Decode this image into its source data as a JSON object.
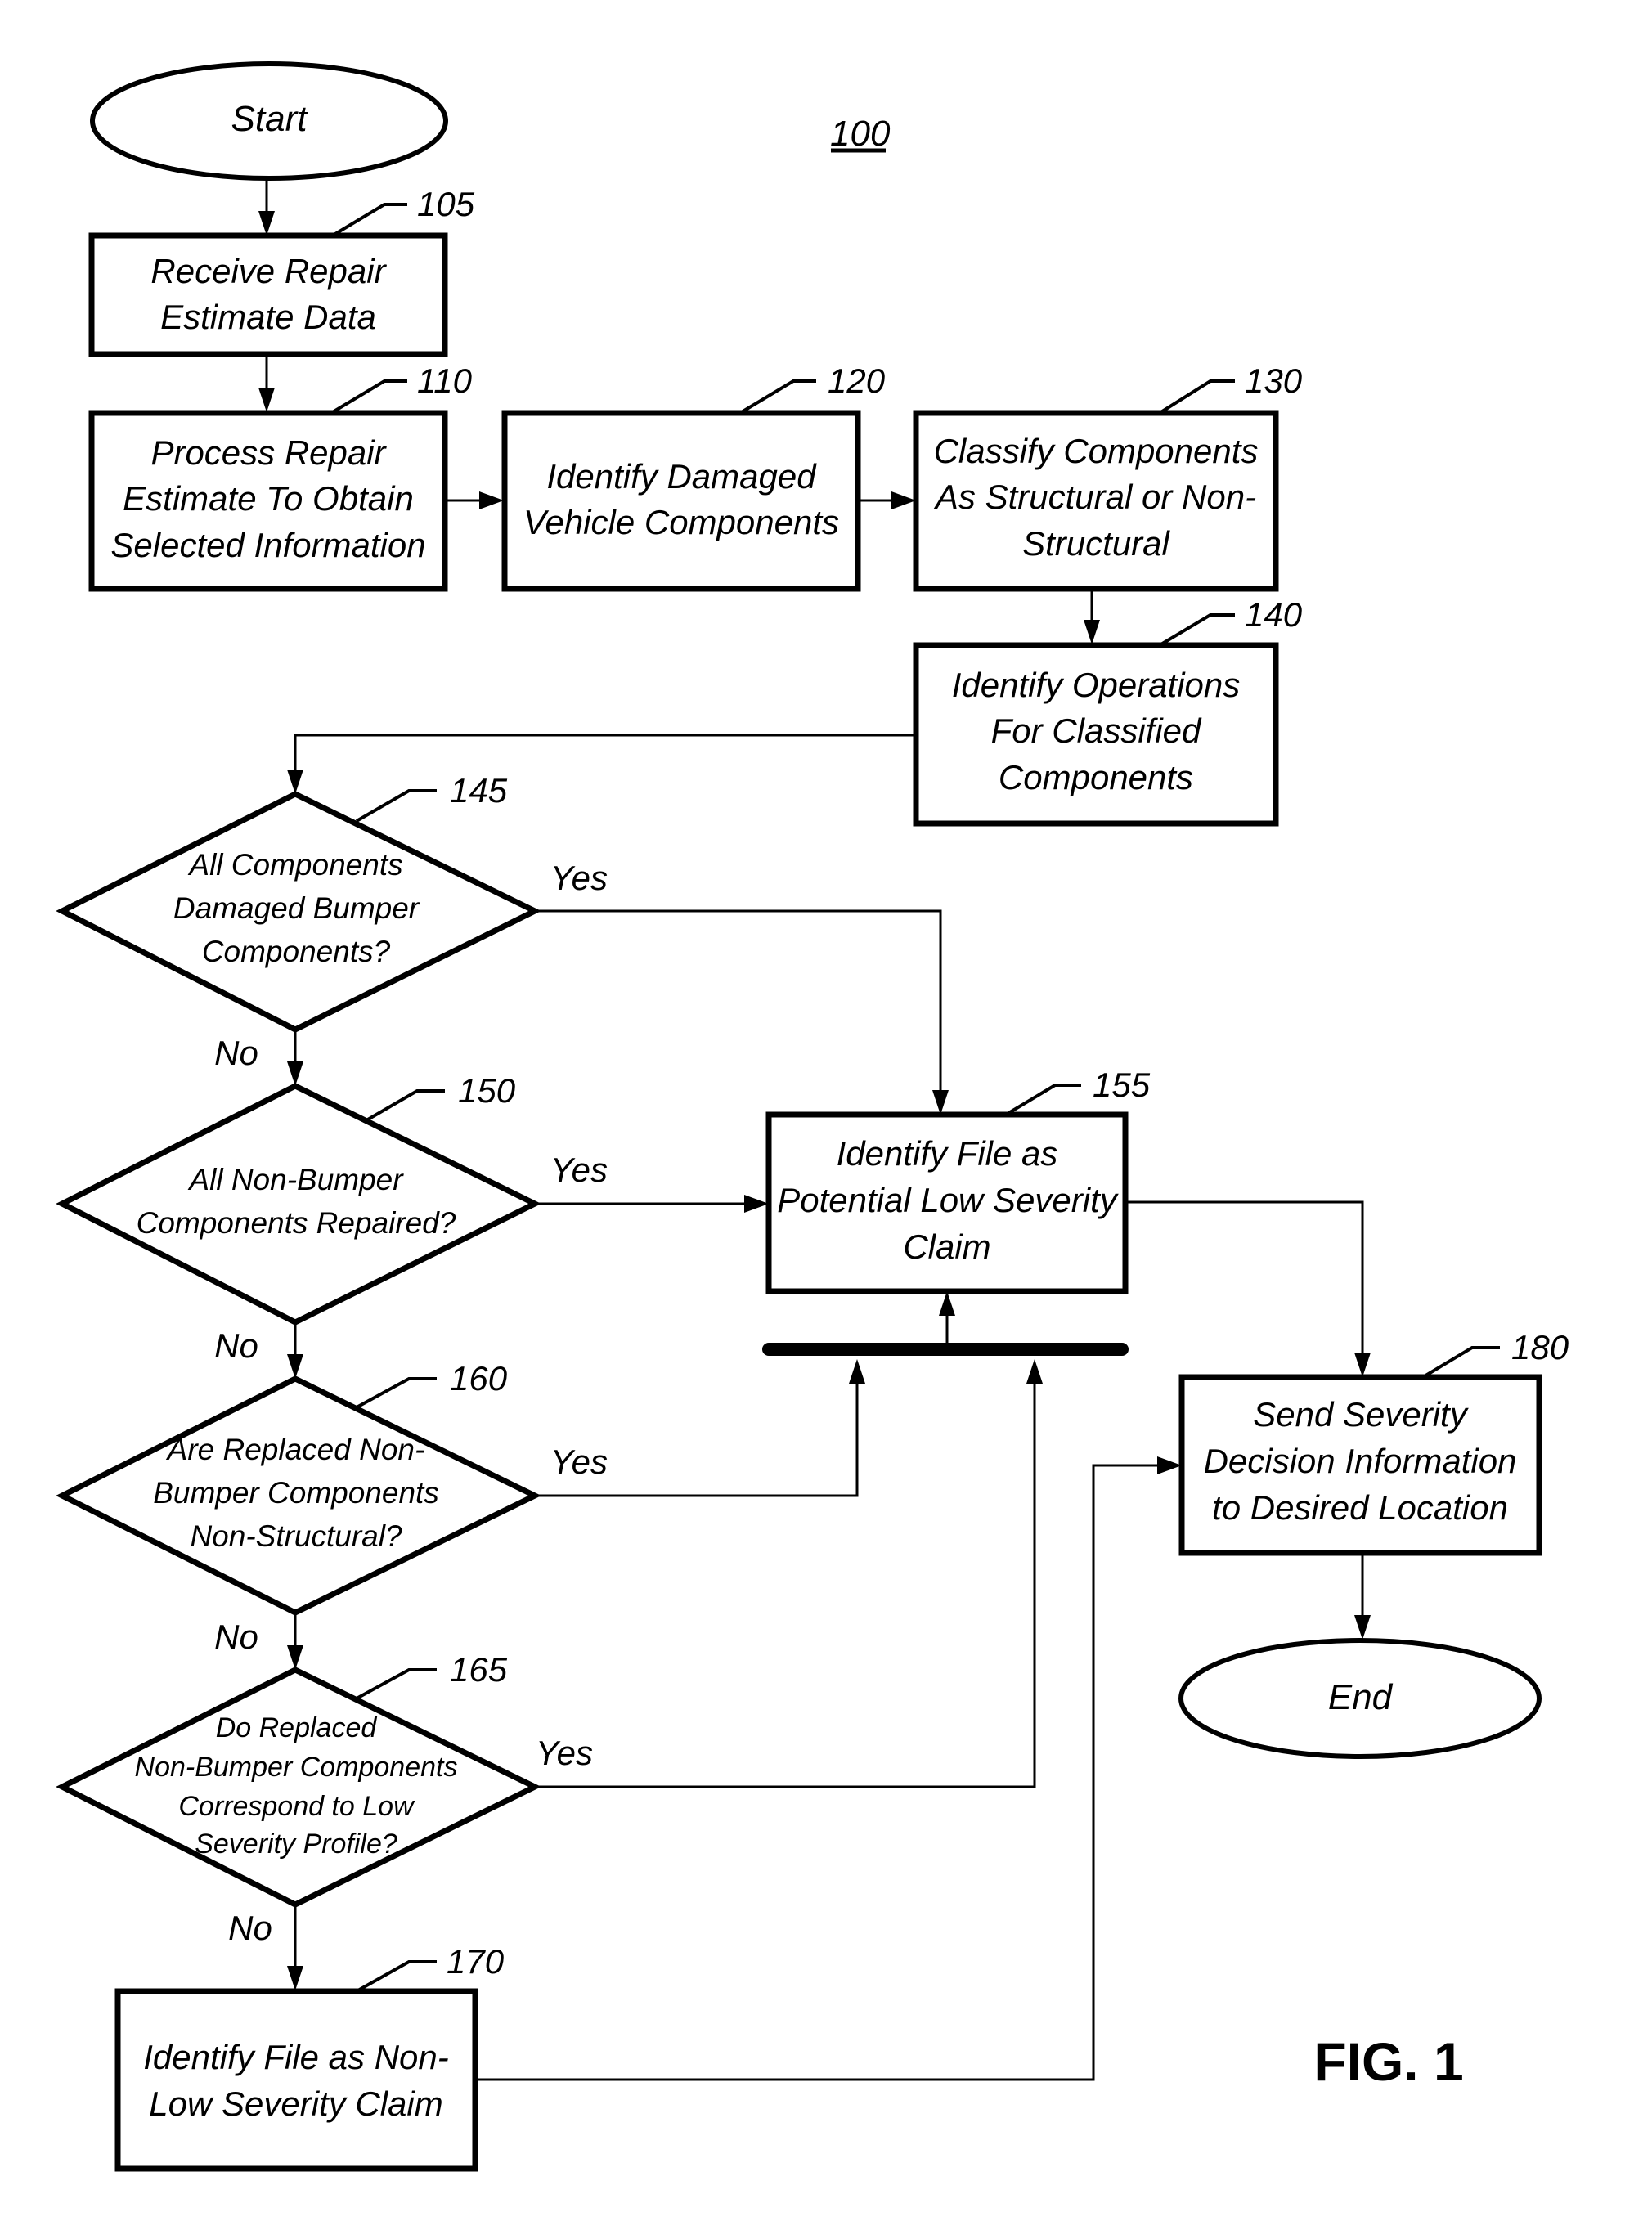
{
  "figure": {
    "number_label": "100",
    "caption": "FIG. 1"
  },
  "nodes": {
    "start": {
      "label": "Start"
    },
    "end": {
      "label": "End"
    },
    "n105": {
      "ref": "105",
      "lines": [
        "Receive Repair",
        "Estimate Data"
      ]
    },
    "n110": {
      "ref": "110",
      "lines": [
        "Process Repair",
        "Estimate To Obtain",
        "Selected Information"
      ]
    },
    "n120": {
      "ref": "120",
      "lines": [
        "Identify Damaged",
        "Vehicle Components"
      ]
    },
    "n130": {
      "ref": "130",
      "lines": [
        "Classify Components",
        "As Structural or Non-",
        "Structural"
      ]
    },
    "n140": {
      "ref": "140",
      "lines": [
        "Identify Operations",
        "For Classified",
        "Components"
      ]
    },
    "n145": {
      "ref": "145",
      "lines": [
        "All Components",
        "Damaged Bumper",
        "Components?"
      ]
    },
    "n150": {
      "ref": "150",
      "lines": [
        "All Non-Bumper",
        "Components Repaired?"
      ]
    },
    "n155": {
      "ref": "155",
      "lines": [
        "Identify File as",
        "Potential Low Severity",
        "Claim"
      ]
    },
    "n160": {
      "ref": "160",
      "lines": [
        "Are Replaced Non-",
        "Bumper Components",
        "Non-Structural?"
      ]
    },
    "n165": {
      "ref": "165",
      "lines": [
        "Do Replaced",
        "Non-Bumper Components",
        "Correspond to Low",
        "Severity Profile?"
      ]
    },
    "n170": {
      "ref": "170",
      "lines": [
        "Identify File as Non-",
        "Low Severity Claim"
      ]
    },
    "n180": {
      "ref": "180",
      "lines": [
        "Send Severity",
        "Decision Information",
        "to Desired Location"
      ]
    }
  },
  "branches": {
    "yes": "Yes",
    "no": "No"
  }
}
